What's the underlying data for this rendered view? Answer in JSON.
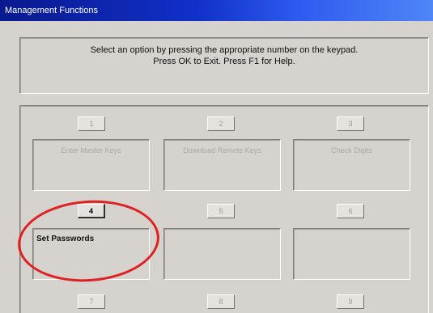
{
  "window": {
    "title": "Management Functions"
  },
  "instructions": {
    "line1": "Select an option by pressing the appropriate number on the keypad.",
    "line2": "Press OK to Exit. Press F1 for Help."
  },
  "options": [
    {
      "number": "1",
      "label": "Enter Master Keys",
      "enabled": false
    },
    {
      "number": "2",
      "label": "Download Remote Keys",
      "enabled": false
    },
    {
      "number": "3",
      "label": "Check Digits",
      "enabled": false
    },
    {
      "number": "4",
      "label": "Set Passwords",
      "enabled": true
    },
    {
      "number": "5",
      "label": "",
      "enabled": false
    },
    {
      "number": "6",
      "label": "",
      "enabled": false
    },
    {
      "number": "7",
      "label": "",
      "enabled": false
    },
    {
      "number": "8",
      "label": "",
      "enabled": false
    },
    {
      "number": "9",
      "label": "",
      "enabled": false
    }
  ],
  "colors": {
    "highlight": "#e02020",
    "titlebar_start": "#0a1a8e",
    "titlebar_end": "#4f86f7"
  }
}
